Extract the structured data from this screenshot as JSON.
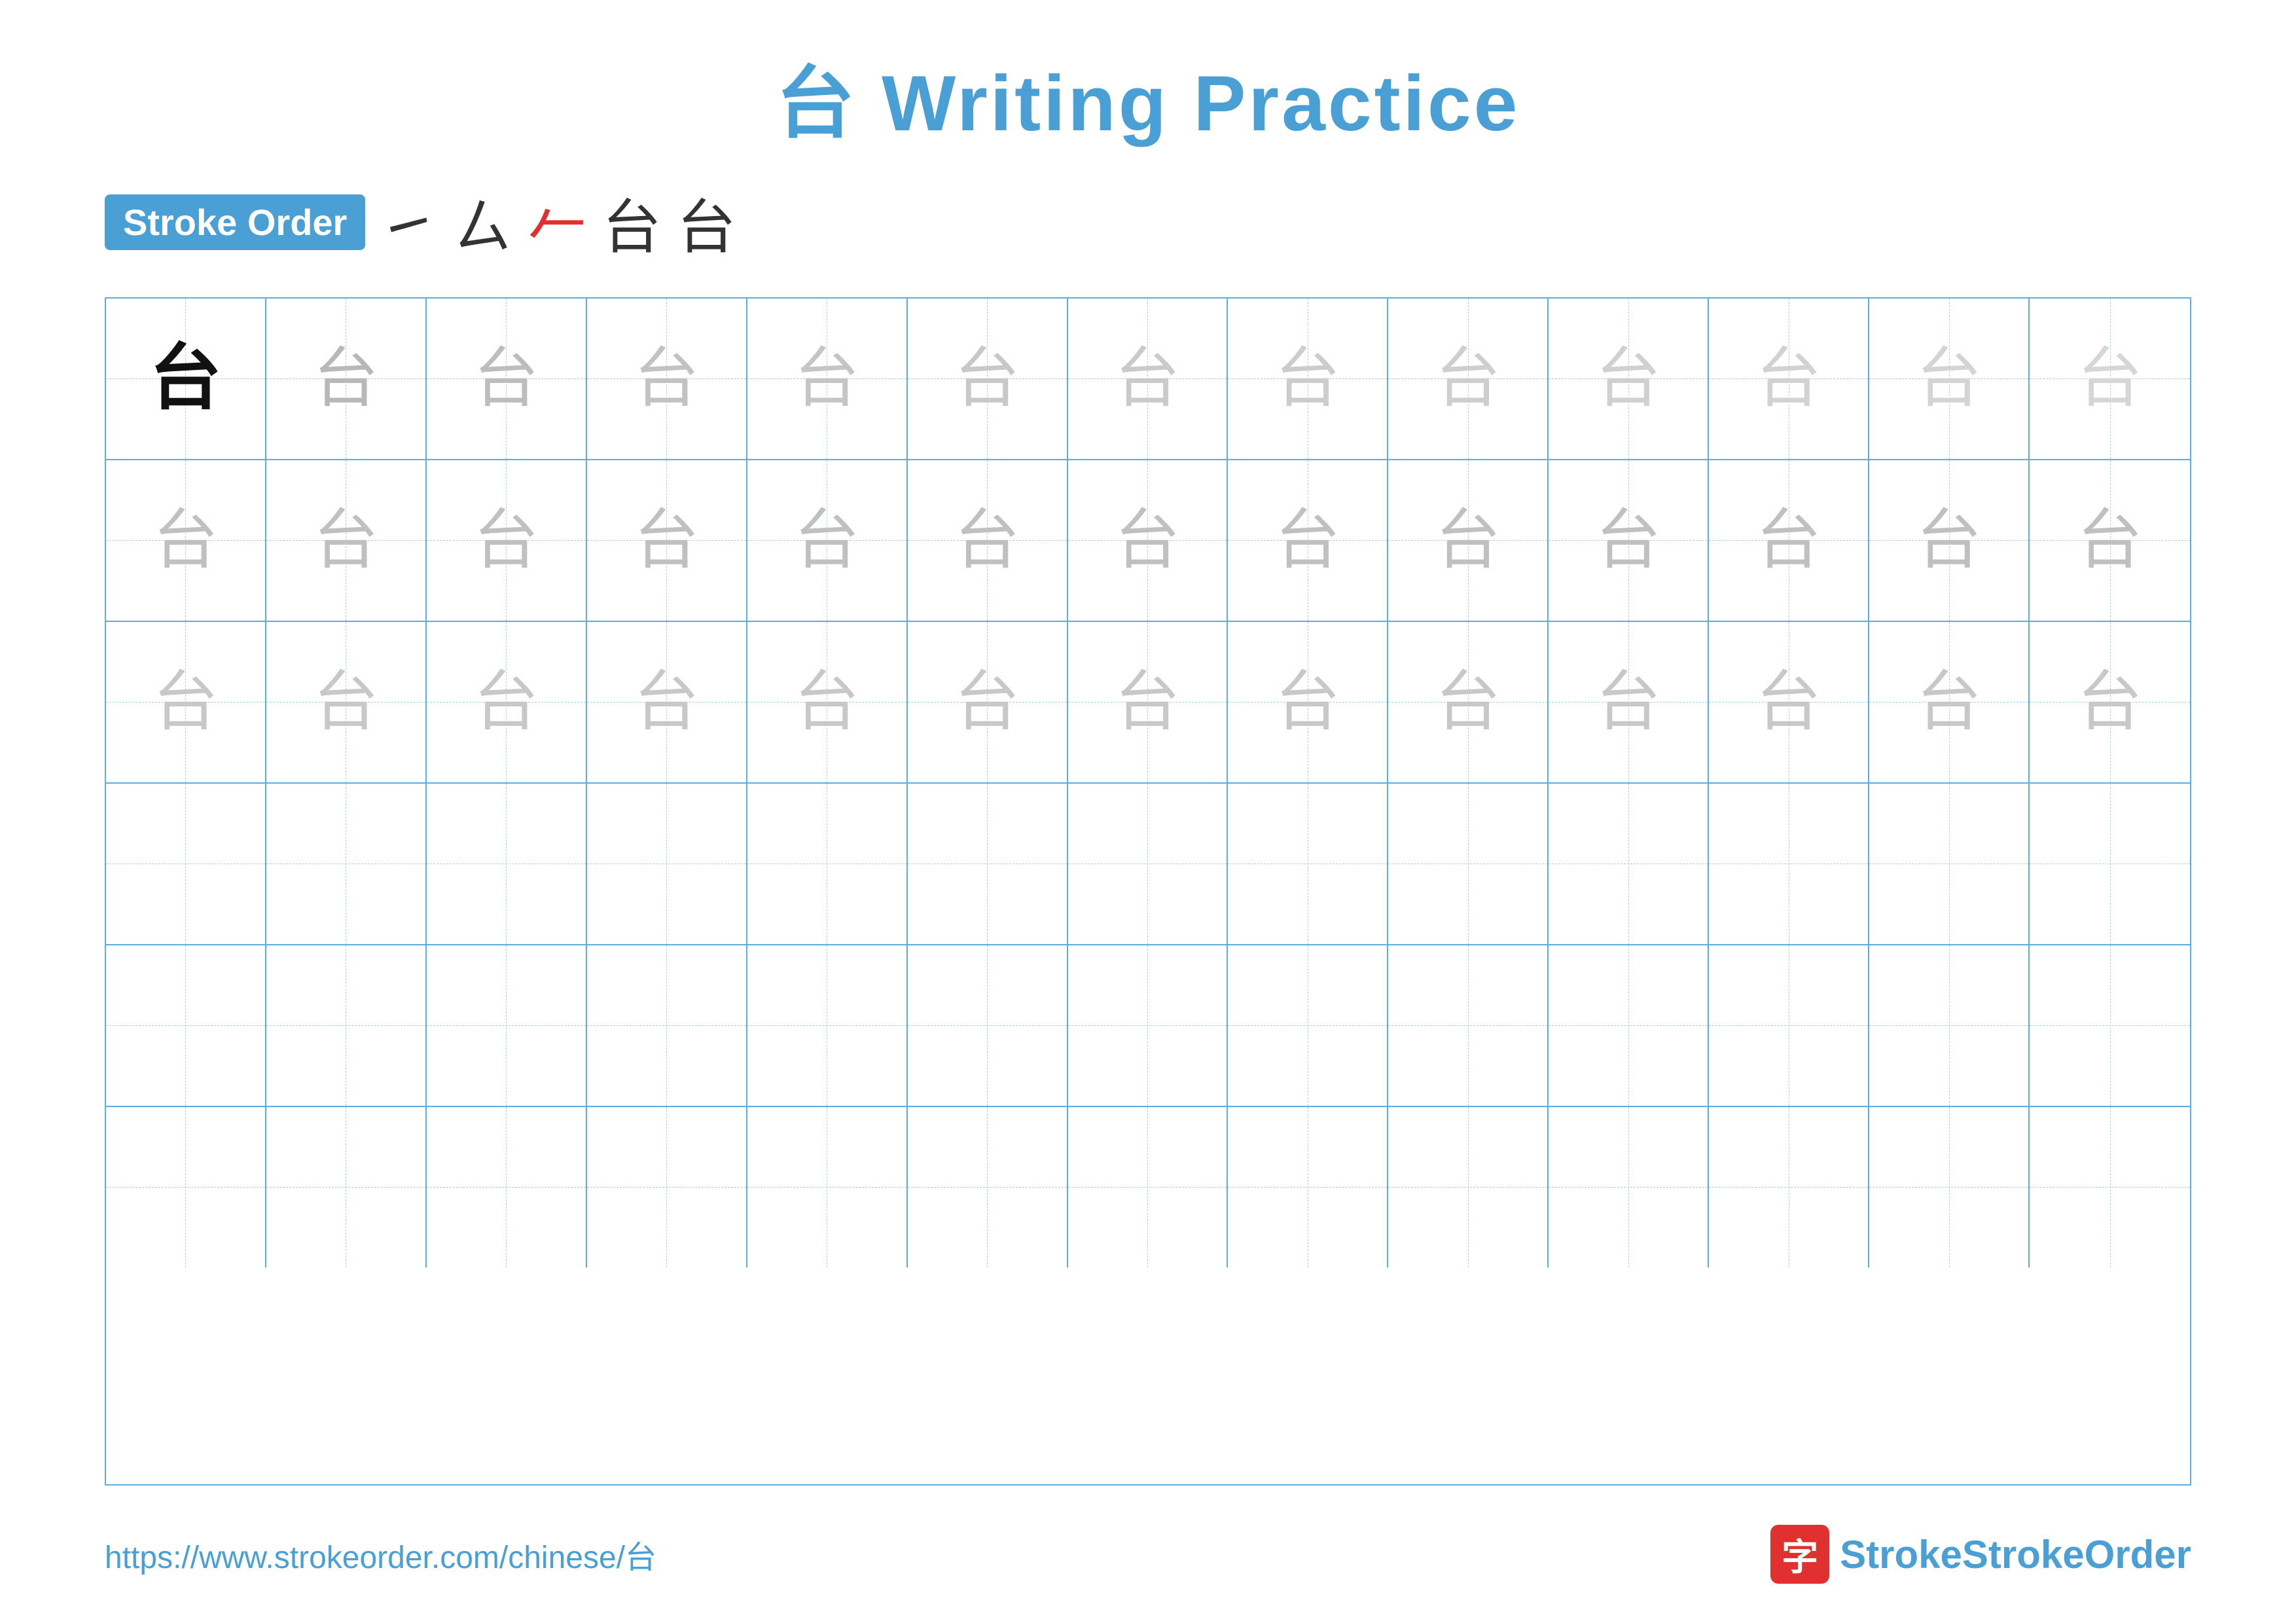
{
  "title": {
    "chinese": "台",
    "english": "Writing Practice"
  },
  "strokeOrder": {
    "badge": "Stroke Order",
    "strokes": [
      "㇀",
      "ㄙ",
      "𠂉",
      "台",
      "台"
    ]
  },
  "grid": {
    "rows": 6,
    "cols": 13,
    "character": "台"
  },
  "footer": {
    "url": "https://www.strokeorder.com/chinese/台",
    "logoText": "StrokeOrder"
  }
}
